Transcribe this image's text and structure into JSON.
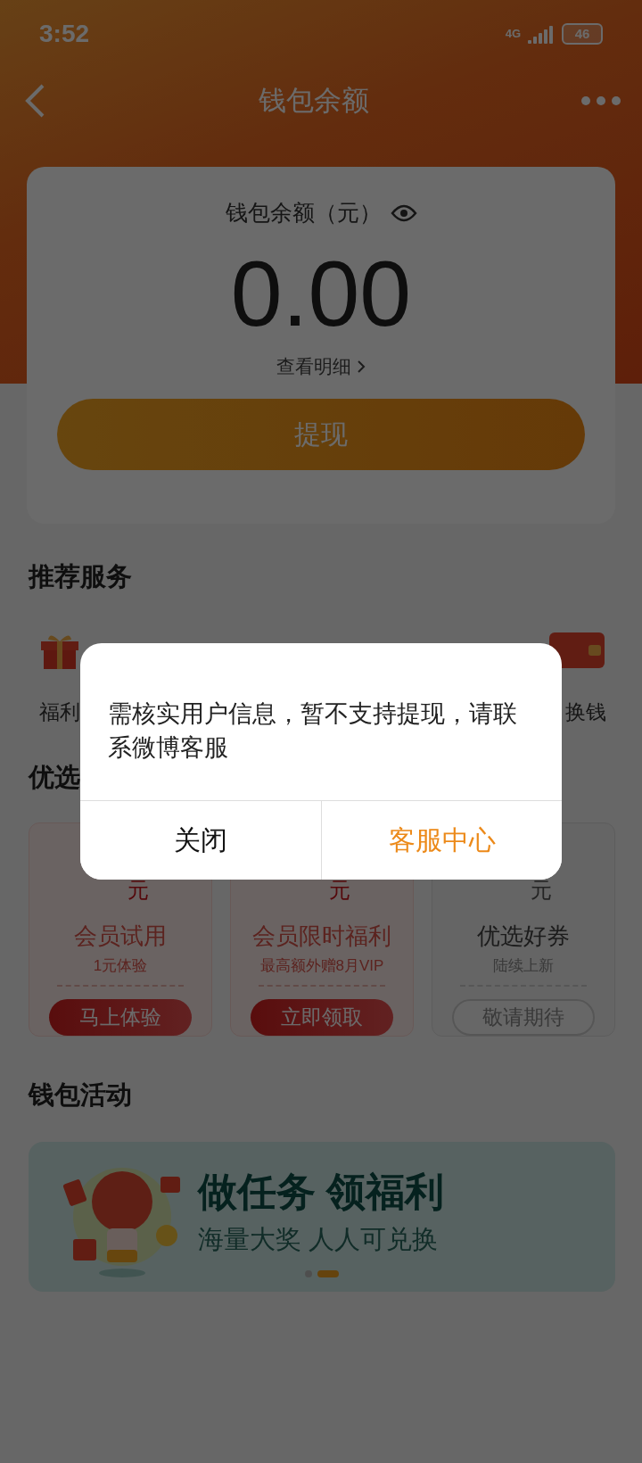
{
  "status_bar": {
    "time": "3:52",
    "network": "4G",
    "battery": "46"
  },
  "nav": {
    "title": "钱包余额"
  },
  "balance_card": {
    "label": "钱包余额（元）",
    "amount": "0.00",
    "details_link": "查看明细",
    "withdraw_button": "提现"
  },
  "recommended": {
    "title": "推荐服务",
    "items": [
      {
        "label": "福利"
      },
      {
        "label": "换钱"
      }
    ]
  },
  "coupons": {
    "title": "优选",
    "items": [
      {
        "unit": "元",
        "title": "会员试用",
        "subtitle": "1元体验",
        "button": "马上体验",
        "available": true
      },
      {
        "unit": "元",
        "title": "会员限时福利",
        "subtitle": "最高额外赠8月VIP",
        "button": "立即领取",
        "available": true
      },
      {
        "unit": "元",
        "title": "优选好券",
        "subtitle": "陆续上新",
        "button": "敬请期待",
        "available": false
      }
    ]
  },
  "activities": {
    "title": "钱包活动",
    "banner": {
      "headline": "做任务 领福利",
      "subline": "海量大奖 人人可兑换",
      "slides": [
        {
          "selected": false
        },
        {
          "selected": true
        }
      ]
    }
  },
  "dialog": {
    "message": "需核实用户信息，暂不支持提现，请联系微博客服",
    "buttons": [
      {
        "label": "关闭",
        "kind": "cancel"
      },
      {
        "label": "客服中心",
        "kind": "primary"
      }
    ]
  }
}
